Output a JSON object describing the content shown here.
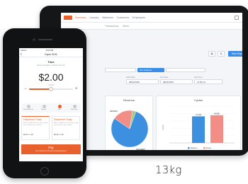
{
  "tablet": {
    "nav": {
      "items": [
        "Summary",
        "Laundry",
        "Machines",
        "Customers",
        "Employees"
      ]
    },
    "subnav": {
      "items": [
        "Transactions",
        "Alerts"
      ]
    },
    "toolbar": {
      "new_report": "New Report"
    },
    "filters": {
      "location": "All Locations"
    },
    "fields": [
      {
        "label": "Start Date",
        "value": "08/01/2020"
      },
      {
        "label": "End Date",
        "value": "08/31/2020"
      },
      {
        "label": "End Time",
        "value": "11:59 pm"
      }
    ],
    "revenue_card": {
      "title": "Revenue"
    },
    "cycles_card": {
      "title": "Cycles"
    }
  },
  "chart_data": [
    {
      "type": "pie",
      "title": "Revenue",
      "categories": [
        "Washers",
        "Dryers",
        "Other"
      ],
      "values": [
        79,
        18,
        3
      ],
      "slice_labels": [
        "WASHERS",
        "DRYERS"
      ],
      "colors": [
        "#3d8fe0",
        "#f28e86",
        "#9ecb7d"
      ]
    },
    {
      "type": "bar",
      "title": "Cycles",
      "categories": [
        "Washers",
        "Dryers"
      ],
      "values": [
        47,
        49
      ],
      "value_labels": [
        "47,436",
        "49,800"
      ],
      "ylabel": "Cycles",
      "ylim": [
        0,
        65
      ],
      "legend": "bottom",
      "colors": [
        "#3d8fe0",
        "#f28e86"
      ],
      "grid": true
    }
  ],
  "phone": {
    "status": {
      "carrier": "Carrier",
      "time": "8:00 AM"
    },
    "header": {
      "back": "‹",
      "title": "Dryer 0101"
    },
    "time": {
      "label": "Time",
      "hint": "Move the slider to adjust the time",
      "price": "$2.00",
      "duration": "12:00",
      "minus": "−",
      "plus": "+"
    },
    "slider": {
      "fraction": 0.5
    },
    "cycles": [
      {
        "label": "Delicate/Perm"
      },
      {
        "label": "Normal"
      },
      {
        "label": "Hot"
      },
      {
        "label": "Extra Hot"
      }
    ],
    "addons": [
      {
        "title": "Dispenser Soap",
        "desc": "Add an additional rinse cycle to give more detail to your clothes",
        "price": "$0.50 / 1.00"
      },
      {
        "title": "Dispenser Soap",
        "desc": "Add an additional rinse cycle to give more detail to your clothes",
        "price": "$0.50 / 1.00"
      }
    ],
    "pay": {
      "label": "Pay",
      "sub": "Your wallet has $11.00 remaining balance"
    }
  },
  "caption": "13kg"
}
